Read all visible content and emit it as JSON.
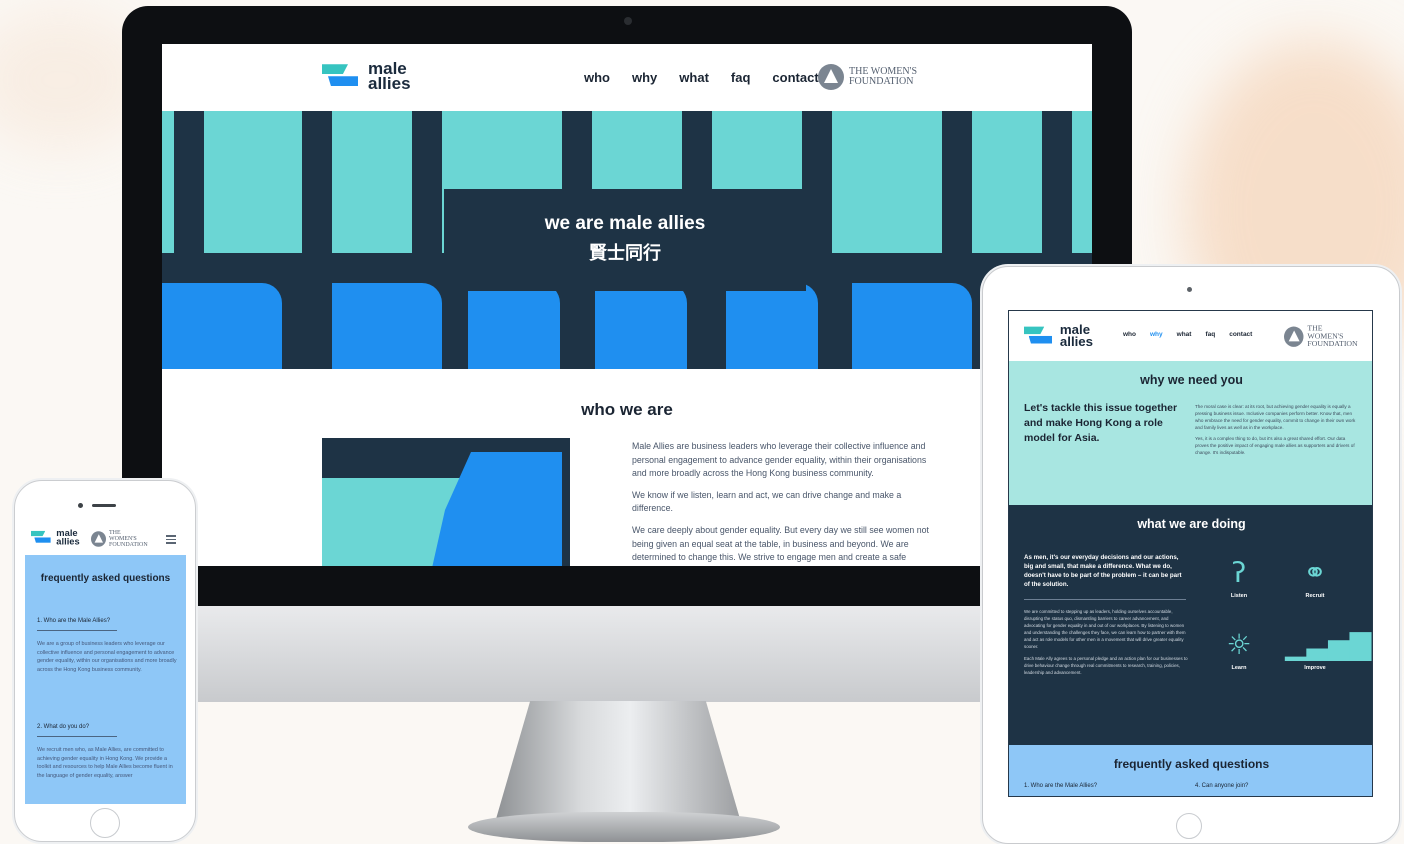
{
  "brand": {
    "logo_line1": "male",
    "logo_line2": "allies",
    "partner_line1": "THE WOMEN'S",
    "partner_line2": "FOUNDATION"
  },
  "colors": {
    "teal": "#6bd6d4",
    "navy": "#1e3345",
    "blue": "#1f8ff0",
    "light_blue": "#8ec7f7",
    "mint": "#a8e6e1"
  },
  "desktop": {
    "nav": [
      "who",
      "why",
      "what",
      "faq",
      "contact"
    ],
    "hero": {
      "title": "we are male allies",
      "subtitle": "賢士同行"
    },
    "who": {
      "title": "who we are",
      "p1": "Male Allies are business leaders who leverage their collective influence and personal engagement to advance gender equality, within their organisations and more broadly across the Hong Kong business community.",
      "p2": "We know if we listen, learn and act, we can drive change and make a difference.",
      "p3": "We care deeply about gender equality. But every day we still see women not being given an equal seat at the table, in business and beyond. We are determined to change this. We strive to engage men and create a safe space for dialogue about gender equality, so they feel comfortable asking questions,"
    }
  },
  "tablet": {
    "nav": [
      "who",
      "why",
      "what",
      "faq",
      "contact"
    ],
    "active_nav": "why",
    "why": {
      "title": "why we need you",
      "lead": "Let's tackle this issue together and make Hong Kong a role model for Asia.",
      "body1": "The moral case is clear: at its root, but achieving gender equality is equally a pressing business issue. Inclusive companies perform better. Know that, men who embrace the need for gender equality, commit to change in their own work and family lives as well as in the workplace.",
      "body2": "Yes, it is a complex thing to do, but it's also a great shared effort. Our data proves the positive impact of engaging male allies as supporters and drivers of change. It's indisputable."
    },
    "doing": {
      "title": "what we are doing",
      "lead": "As men, it's our everyday decisions and our actions, big and small, that make a difference. What we do, doesn't have to be part of the problem – it can be part of the solution.",
      "body1": "We are committed to stepping up as leaders, holding ourselves accountable, disrupting the status quo, dismantling barriers to career advancement, and advocating for gender equality in and out of our workplaces. By listening to women and understanding the challenges they face, we can learn how to partner with them and act as role models for other men in a movement that will drive greater equality sooner.",
      "body2": "Each Male Ally agrees to a personal pledge and an action plan for our businesses to drive behaviour change through real commitments to research, training, policies, leadership and advancement.",
      "icons": [
        {
          "icon": "ear-icon",
          "label": "Listen"
        },
        {
          "icon": "handshake-icon",
          "label": "Recruit"
        },
        {
          "icon": "lightbulb-icon",
          "label": "Learn"
        },
        {
          "icon": "bar-chart-icon",
          "label": "Improve"
        }
      ]
    },
    "faq": {
      "title": "frequently asked questions",
      "q1": "1. Who are the Male Allies?",
      "q4": "4. Can anyone join?"
    }
  },
  "phone": {
    "faq_title": "frequently asked questions",
    "q1": "1. Who are the Male Allies?",
    "a1": "We are a group of business leaders who leverage our collective influence and personal engagement to advance gender equality, within our organisations and more broadly across the Hong Kong business community.",
    "q2": "2. What do you do?",
    "a2": "We recruit men who, as Male Allies, are committed to achieving gender equality in Hong Kong. We provide a toolkit and resources to help Male Allies become fluent in the language of gender equality, answer"
  }
}
